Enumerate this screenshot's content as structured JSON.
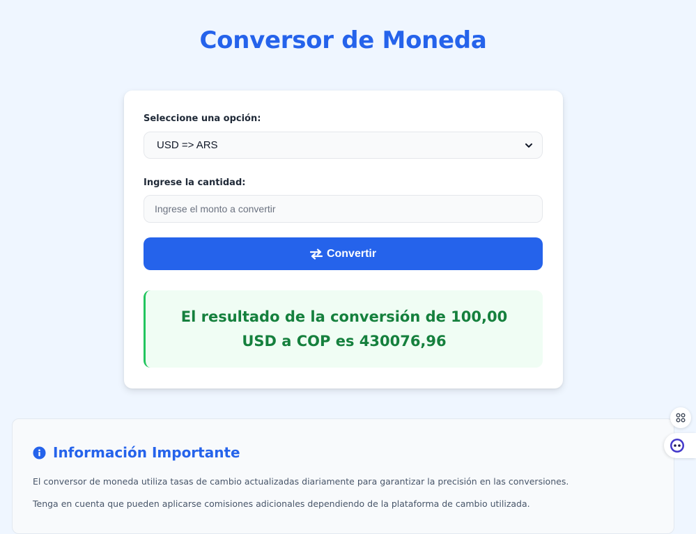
{
  "header": {
    "title": "Conversor de Moneda"
  },
  "form": {
    "select_label": "Seleccione una opción:",
    "selected_option": "USD => ARS",
    "amount_label": "Ingrese la cantidad:",
    "amount_placeholder": "Ingrese el monto a convertir",
    "convert_label": "Convertir"
  },
  "result": {
    "text": "El resultado de la conversión de 100,00 USD a COP es 430076,96"
  },
  "info": {
    "title": "Información Importante",
    "paragraphs": [
      "El conversor de moneda utiliza tasas de cambio actualizadas diariamente para garantizar la precisión en las conversiones.",
      "Tenga en cuenta que pueden aplicarse comisiones adicionales dependiendo de la plataforma de cambio utilizada."
    ]
  },
  "colors": {
    "accent": "#2563eb",
    "success": "#15803d",
    "success_bg": "#f0fdf4",
    "page_bg": "#eff6ff"
  },
  "icons": {
    "convert": "swap-arrows-icon",
    "info": "info-circle-icon",
    "select": "chevron-down-icon",
    "floating_menu": "command-icon",
    "assistant": "assistant-face-icon"
  }
}
